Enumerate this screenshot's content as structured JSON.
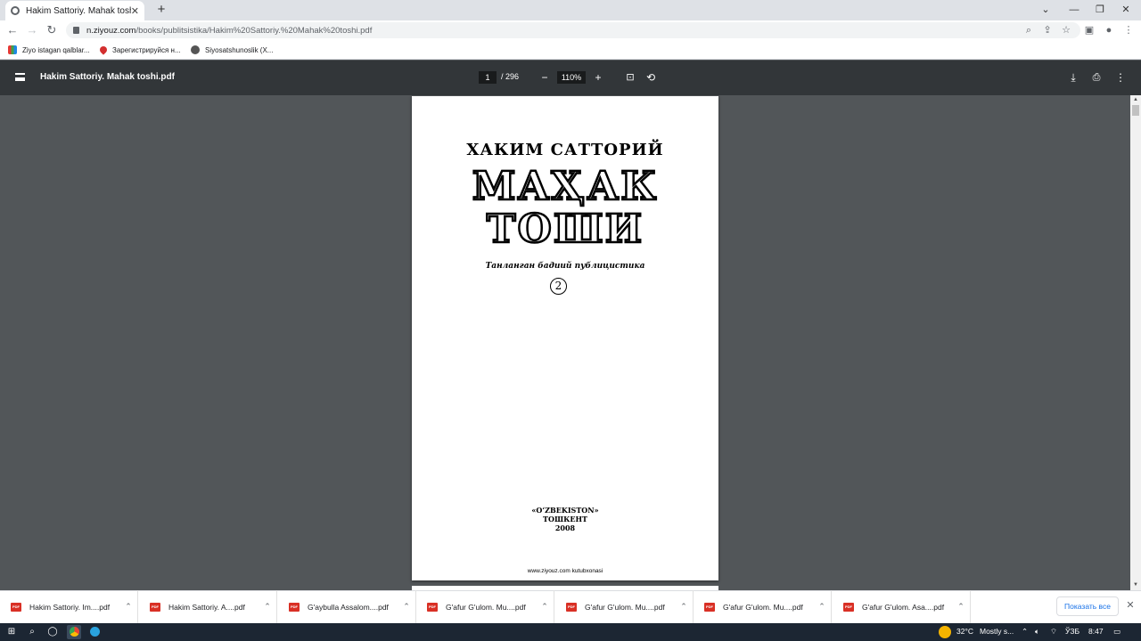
{
  "browser": {
    "tab_title": "Hakim Sattoriy. Mahak toshi.pdf",
    "tab_close": "✕",
    "new_tab": "+",
    "window_controls": [
      "⌄",
      "—",
      "❐",
      "✕"
    ],
    "nav": {
      "back": "←",
      "forward": "→",
      "reload": "↻"
    },
    "url_host": "n.ziyouz.com",
    "url_path": "/books/publitsistika/Hakim%20Sattoriy.%20Mahak%20toshi.pdf",
    "bookmarks": [
      {
        "label": "Ziyo istagan qalblar...",
        "icon": "bar-chart-icon"
      },
      {
        "label": "Зарегистрируйся н...",
        "icon": "heart-icon"
      },
      {
        "label": "Siyosatshunoslik (X...",
        "icon": "globe-icon"
      }
    ]
  },
  "pdf_toolbar": {
    "title": "Hakim Sattoriy. Mahak toshi.pdf",
    "current_page": "1",
    "total_pages": "/ 296",
    "zoom": "110%",
    "zoom_out": "−",
    "zoom_in": "+"
  },
  "page": {
    "author": "ХАКИМ САТТОРИЙ",
    "title_line1": "МАҲАК",
    "title_line2": "ТОШИ",
    "subtitle": "Танланган бадиий публицистика",
    "volume": "2",
    "publisher": "«O‘ZBEKISTON»",
    "city": "ТОШКЕНТ",
    "year": "2008",
    "footer": "www.ziyouz.com kutubxonasi"
  },
  "downloads": {
    "items": [
      "Hakim Sattoriy. Im....pdf",
      "Hakim Sattoriy. A....pdf",
      "G'aybulla Assalom....pdf",
      "G'afur G'ulom. Mu....pdf",
      "G'afur G'ulom. Mu....pdf",
      "G'afur G'ulom. Mu....pdf",
      "G'afur G'ulom. Asa....pdf"
    ],
    "file_type_label": "PDF",
    "show_all": "Показать все"
  },
  "taskbar": {
    "temperature": "32°C",
    "weather": "Mostly s...",
    "language": "ЎЗБ",
    "time": "8:47"
  },
  "colors": {
    "pdf_toolbar": "#323639",
    "viewer_bg": "#525659",
    "taskbar": "#1c2633",
    "link_blue": "#1a73e8"
  }
}
